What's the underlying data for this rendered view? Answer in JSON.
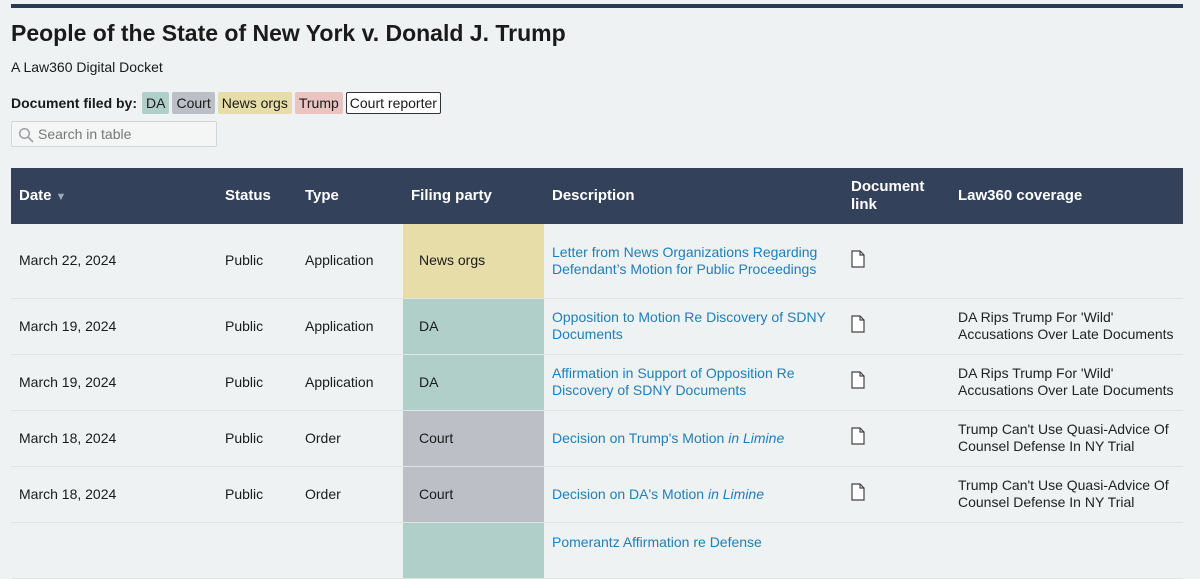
{
  "page": {
    "title": "People of the State of New York v. Donald J. Trump",
    "subtitle": "A Law360 Digital Docket"
  },
  "legend": {
    "label": "Document filed by:",
    "items": [
      {
        "label": "DA",
        "color": "#b0cfc9"
      },
      {
        "label": "Court",
        "color": "#bcc0c6"
      },
      {
        "label": "News orgs",
        "color": "#e6dda8"
      },
      {
        "label": "Trump",
        "color": "#e9c4c0"
      },
      {
        "label": "Court reporter",
        "color": "#ffffff"
      }
    ]
  },
  "search": {
    "placeholder": "Search in table",
    "icon": "search-icon"
  },
  "table": {
    "headers": {
      "date": "Date",
      "status": "Status",
      "type": "Type",
      "filing_party": "Filing party",
      "description": "Description",
      "document_link": "Document link",
      "coverage": "Law360 coverage"
    },
    "sort_indicator": "▼",
    "rows": [
      {
        "date": "March 22, 2024",
        "status": "Public",
        "type": "Application",
        "party": "News orgs",
        "party_color": "#e6dda8",
        "description": "Letter from News Organizations Regarding Defendant’s Motion for Public Proceedings",
        "desc_italic": "",
        "coverage": ""
      },
      {
        "date": "March 19, 2024",
        "status": "Public",
        "type": "Application",
        "party": "DA",
        "party_color": "#b0cfc9",
        "description": "Opposition to Motion Re Discovery of SDNY Documents",
        "desc_italic": "",
        "coverage": "DA Rips Trump For 'Wild' Accusations Over Late Documents"
      },
      {
        "date": "March 19, 2024",
        "status": "Public",
        "type": "Application",
        "party": "DA",
        "party_color": "#b0cfc9",
        "description": "Affirmation in Support of Opposition Re Discovery of SDNY Documents",
        "desc_italic": "",
        "coverage": "DA Rips Trump For 'Wild' Accusations Over Late Documents"
      },
      {
        "date": "March 18, 2024",
        "status": "Public",
        "type": "Order",
        "party": "Court",
        "party_color": "#bcc0c6",
        "description": "Decision on Trump's Motion ",
        "desc_italic": "in Limine",
        "coverage": "Trump Can't Use Quasi-Advice Of Counsel Defense In NY Trial"
      },
      {
        "date": "March 18, 2024",
        "status": "Public",
        "type": "Order",
        "party": "Court",
        "party_color": "#bcc0c6",
        "description": "Decision on DA's Motion ",
        "desc_italic": "in Limine",
        "coverage": "Trump Can't Use Quasi-Advice Of Counsel Defense In NY Trial"
      },
      {
        "date": "",
        "status": "",
        "type": "",
        "party": "",
        "party_color": "#b0cfc9",
        "description": "Pomerantz Affirmation re Defense",
        "desc_italic": "",
        "coverage": ""
      }
    ]
  }
}
